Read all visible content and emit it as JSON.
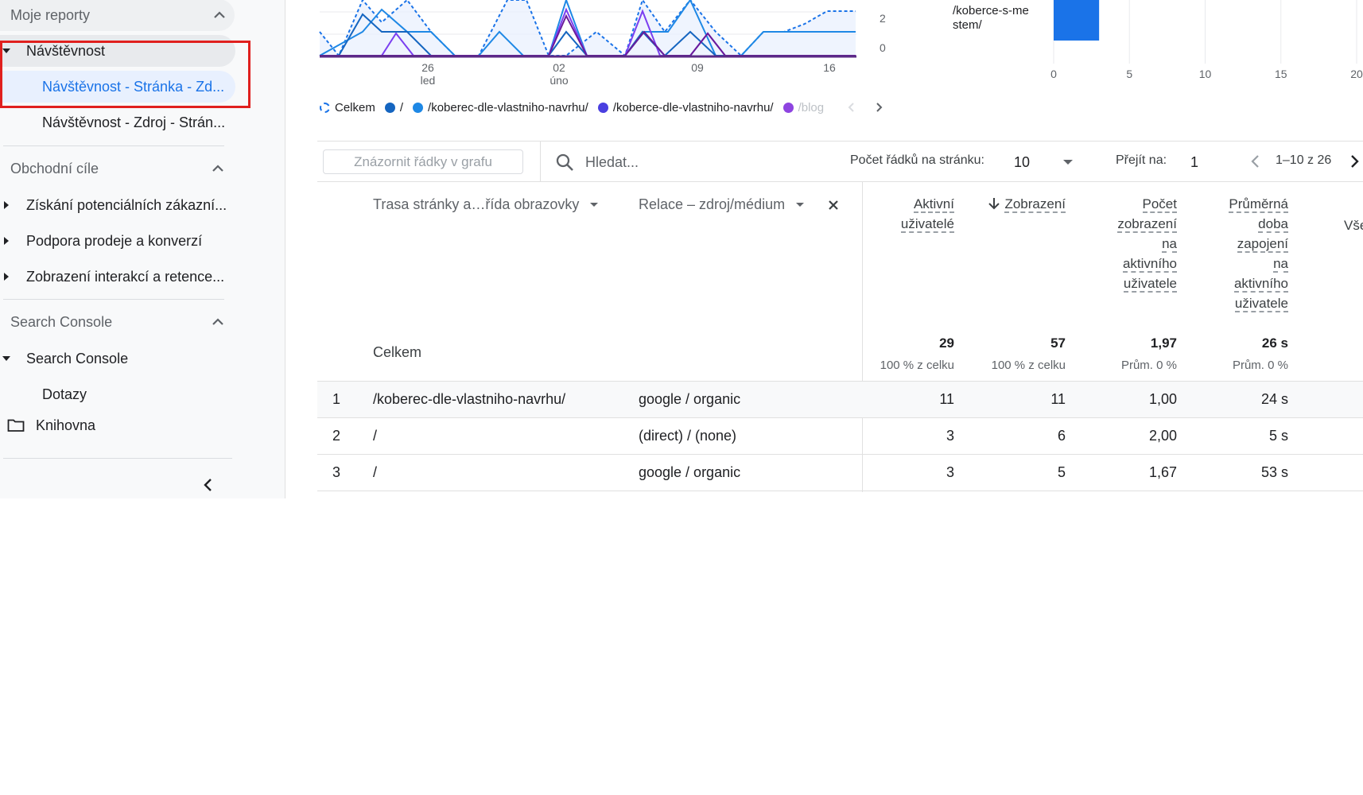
{
  "sidebar": {
    "my_reports": {
      "label": "Moje reporty",
      "items": [
        {
          "label": "Návštěvnost"
        },
        {
          "label": "Návštěvnost - Stránka - Zd..."
        },
        {
          "label": "Návštěvnost - Zdroj - Strán..."
        }
      ]
    },
    "business_goals": {
      "label": "Obchodní cíle",
      "items": [
        {
          "label": "Získání potenciálních zákazní..."
        },
        {
          "label": "Podpora prodeje a konverzí"
        },
        {
          "label": "Zobrazení interakcí a retence..."
        }
      ]
    },
    "search_console": {
      "label": "Search Console",
      "items": [
        {
          "label": "Search Console"
        },
        {
          "label": "Dotazy"
        }
      ]
    },
    "library": {
      "label": "Knihovna"
    }
  },
  "line_chart": {
    "y_ticks": [
      "2",
      "0"
    ],
    "x_ticks": [
      {
        "day": "26",
        "month": "led"
      },
      {
        "day": "02",
        "month": "úno"
      },
      {
        "day": "09",
        "month": ""
      },
      {
        "day": "16",
        "month": ""
      }
    ]
  },
  "legend": {
    "items": [
      {
        "label": "Celkem"
      },
      {
        "label": "/"
      },
      {
        "label": "/koberec-dle-vlastniho-navrhu/"
      },
      {
        "label": "/koberce-dle-vlastniho-navrhu/"
      },
      {
        "label": "/blog"
      }
    ]
  },
  "chart_data": {
    "type": "bar",
    "categories": [
      "/koberce-s-mestem/"
    ],
    "category_label_lines": [
      "/koberce-s-me",
      "stem/"
    ],
    "values": [
      3
    ],
    "x_ticks": [
      "0",
      "5",
      "10",
      "15",
      "20"
    ],
    "xlim": [
      0,
      20
    ],
    "orientation": "horizontal",
    "color": "#1a73e8"
  },
  "toolbar": {
    "plot_rows_label": "Znázornit řádky v grafu",
    "search_placeholder": "Hledat...",
    "rows_per_page_label": "Počet řádků na stránku:",
    "rows_per_page_value": "10",
    "go_to_label": "Přejít na:",
    "go_to_value": "1",
    "range_label": "1–10 z 26"
  },
  "table": {
    "dimension_headers": [
      "Trasa stránky a…řída obrazovky",
      "Relace – zdroj/médium"
    ],
    "metric_headers": [
      [
        "Aktivní",
        "uživatelé"
      ],
      [
        "Zobrazení"
      ],
      [
        "Počet",
        "zobrazení",
        "na",
        "aktivního",
        "uživatele"
      ],
      [
        "Průměrná",
        "doba",
        "zapojení",
        "na",
        "aktivního",
        "uživatele"
      ]
    ],
    "cut_header": "Vše",
    "totals": {
      "label": "Celkem",
      "values": [
        "29",
        "57",
        "1,97",
        "26 s"
      ],
      "subs": [
        "100 % z celku",
        "100 % z celku",
        "Prům. 0 %",
        "Prům. 0 %"
      ]
    },
    "rows": [
      {
        "idx": "1",
        "page": "/koberec-dle-vlastniho-navrhu/",
        "source": "google / organic",
        "active": "11",
        "views": "11",
        "ratio": "1,00",
        "engagement": "24 s"
      },
      {
        "idx": "2",
        "page": "/",
        "source": "(direct) / (none)",
        "active": "3",
        "views": "6",
        "ratio": "2,00",
        "engagement": "5 s"
      },
      {
        "idx": "3",
        "page": "/",
        "source": "google / organic",
        "active": "3",
        "views": "5",
        "ratio": "1,67",
        "engagement": "53 s"
      }
    ]
  }
}
